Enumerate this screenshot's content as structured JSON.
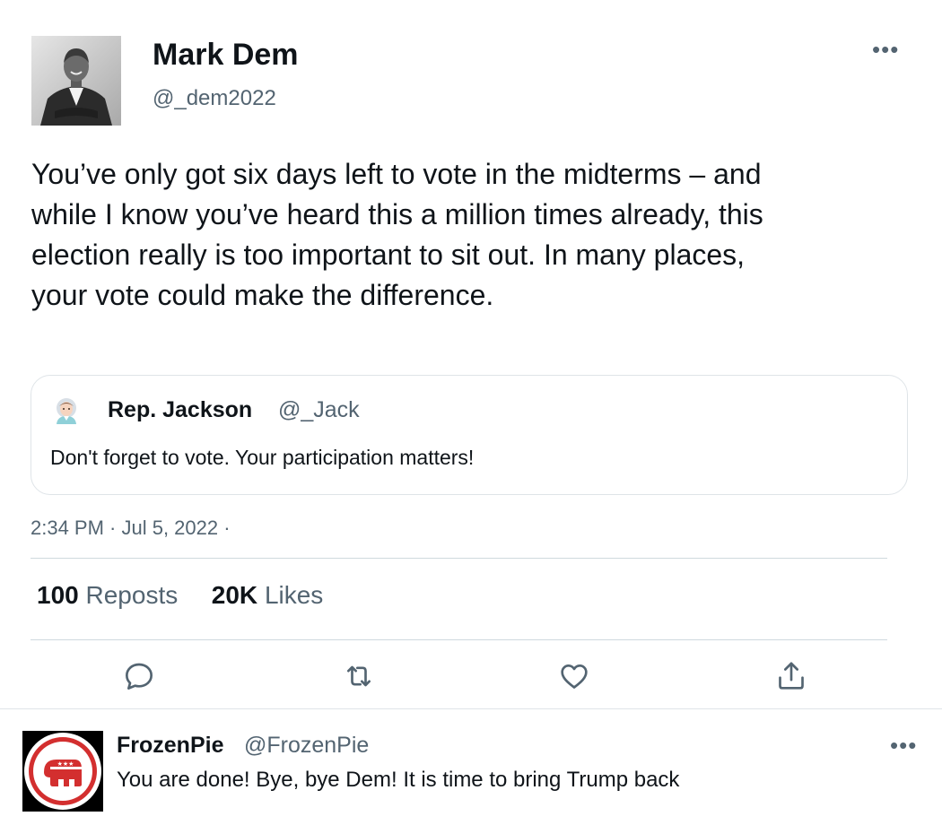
{
  "tweet": {
    "author": {
      "display_name": "Mark Dem",
      "handle": "@_dem2022",
      "avatar": "profile-photo"
    },
    "more_icon": "•••",
    "text": "You’ve only got six days left to vote in the midterms – and while I know you’ve heard this a million times already, this election really is too important to sit out. In many places, your vote could make the difference.",
    "quote": {
      "avatar": "person-emoji-icon",
      "display_name": "Rep. Jackson",
      "handle": "@_Jack",
      "text": "Don't forget to vote. Your participation matters!"
    },
    "timestamp": "2:34 PM · Jul 5, 2022 ·",
    "stats": {
      "reposts_count": "100",
      "reposts_label": "Reposts",
      "likes_count": "20K",
      "likes_label": "Likes"
    },
    "actions": [
      "reply-icon",
      "repost-icon",
      "like-icon",
      "share-icon"
    ]
  },
  "reply": {
    "author": {
      "display_name": "FrozenPie",
      "handle": "@FrozenPie",
      "avatar": "republican-elephant-logo"
    },
    "more_icon": "•••",
    "text": "You are done! Bye, bye Dem! It is time to bring Trump back"
  },
  "colors": {
    "text_primary": "#0f1419",
    "text_secondary": "#536471",
    "divider": "#cfd9de",
    "logo_red": "#d32f2f"
  }
}
